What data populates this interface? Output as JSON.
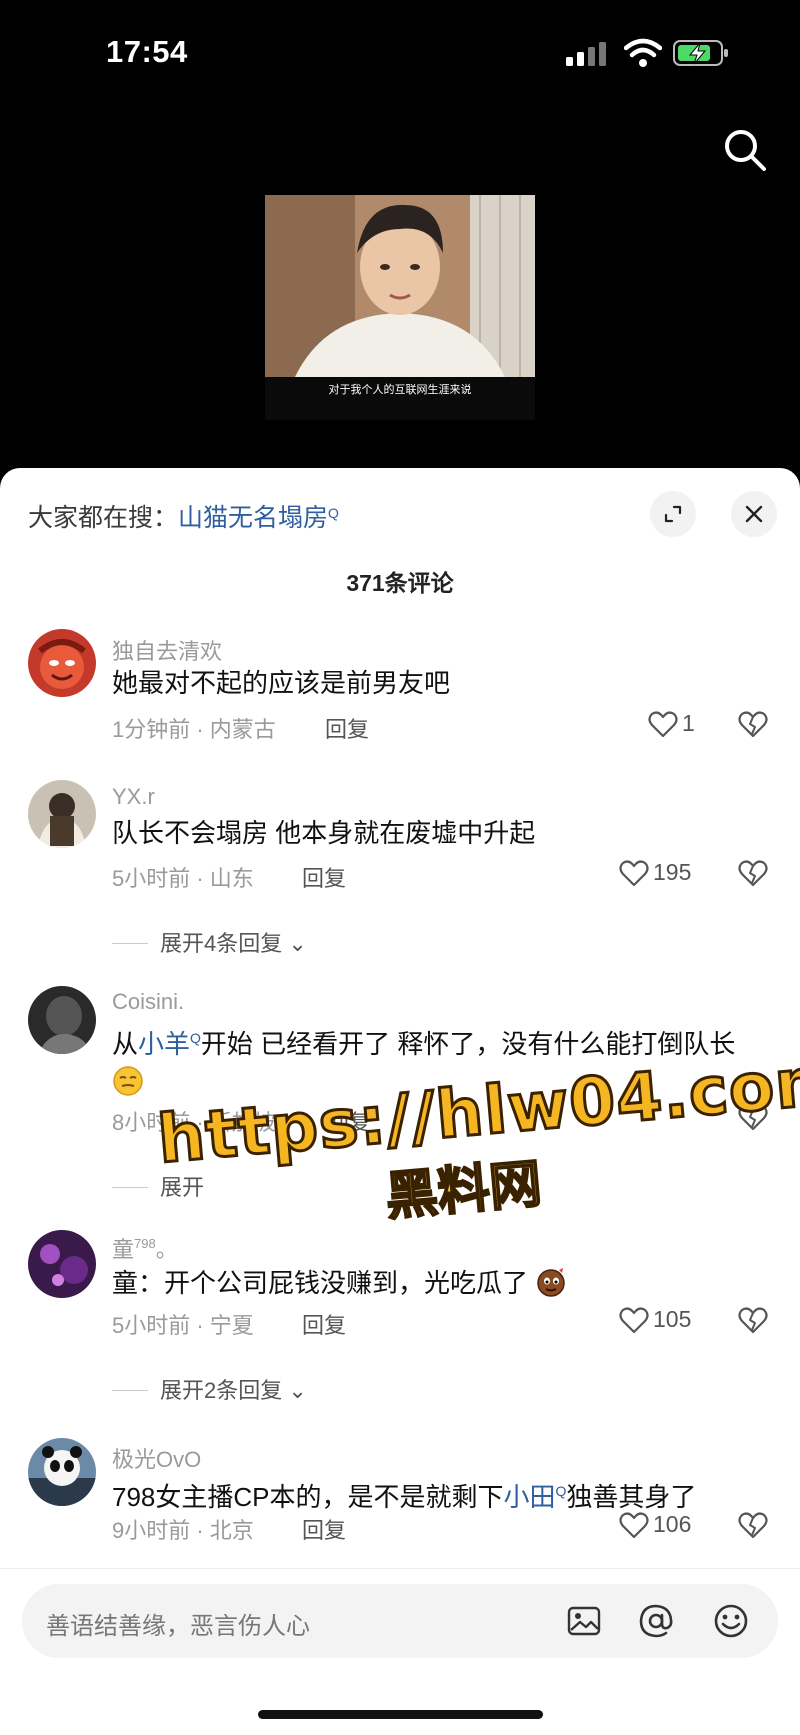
{
  "status_bar": {
    "time": "17:54"
  },
  "video": {
    "subtitle": "对于我个人的互联网生涯来说"
  },
  "hot_search": {
    "label": "大家都在搜：",
    "term": "山猫无名塌房"
  },
  "comment_count": "371条评论",
  "comments": [
    {
      "username": "独自去清欢",
      "text": "她最对不起的应该是前男友吧",
      "meta": "1分钟前 · 内蒙古",
      "reply": "回复",
      "likes": "1"
    },
    {
      "username": "YX.r",
      "text": "队长不会塌房 他本身就在废墟中升起",
      "meta": "5小时前 · 山东",
      "reply": "回复",
      "likes": "195",
      "expand": "展开4条回复"
    },
    {
      "username": "Coisini.",
      "text_before": "从",
      "mention": "小羊",
      "text_after": "开始 已经看开了 释怀了，没有什么能打倒队长",
      "meta": "8小时前 · 新加坡",
      "reply": "回复",
      "expand": "展开"
    },
    {
      "username": "童",
      "username_sup": "798",
      "username_suffix": "。",
      "text": "童：开个公司屁钱没赚到，光吃瓜了",
      "meta": "5小时前 · 宁夏",
      "reply": "回复",
      "likes": "105",
      "expand": "展开2条回复"
    },
    {
      "username": "极光OvO",
      "text_before": "798女主播CP本的，是不是就剩下",
      "mention": "小田",
      "text_after": "独善其身了",
      "meta": "9小时前 · 北京",
      "reply": "回复",
      "likes": "106"
    }
  ],
  "watermark": {
    "url": "https://hlw04.com",
    "sub": "黑料网"
  },
  "input": {
    "placeholder": "善语结善缘，恶言伤人心"
  },
  "icons": {
    "search": "search-icon",
    "expand": "expand-icon",
    "close": "close-icon",
    "like": "heart-icon",
    "dislike": "broken-heart-icon",
    "image": "image-icon",
    "mention": "at-icon",
    "emoji": "smile-icon"
  },
  "colors": {
    "accent": "#2f5f9e",
    "watermark": "#f5b622"
  }
}
